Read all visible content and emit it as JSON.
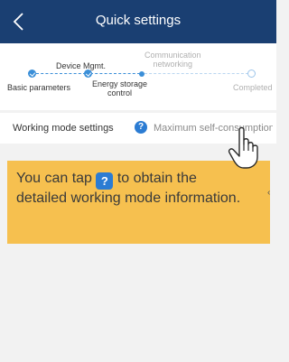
{
  "header": {
    "title": "Quick settings",
    "back_icon": "chevron-left-icon",
    "background": "#1a3f72"
  },
  "stepper": {
    "steps": [
      {
        "label": "Basic parameters",
        "status": "done"
      },
      {
        "label": "Device Mgmt.",
        "status": "done"
      },
      {
        "label": "Energy storage control",
        "status": "current"
      },
      {
        "label": "Communication networking",
        "status": "todo"
      },
      {
        "label": "Completed",
        "status": "todo"
      }
    ],
    "energy_storage_line1": "Energy storage",
    "energy_storage_line2": "control",
    "communication_line1": "Communication",
    "communication_line2": "networking",
    "accent": "#3b8fd8"
  },
  "mode_row": {
    "label": "Working mode settings",
    "help_icon": "question-mark-icon",
    "help_glyph": "?",
    "value": "Maximum self-consumption"
  },
  "callout": {
    "text_before": "You can tap",
    "text_after": "to obtain the detailed working mode information.",
    "icon_glyph": "?",
    "background": "#f6c04f",
    "arrow": "‹"
  },
  "overlay": {
    "pointer_icon": "hand-pointer-icon"
  }
}
